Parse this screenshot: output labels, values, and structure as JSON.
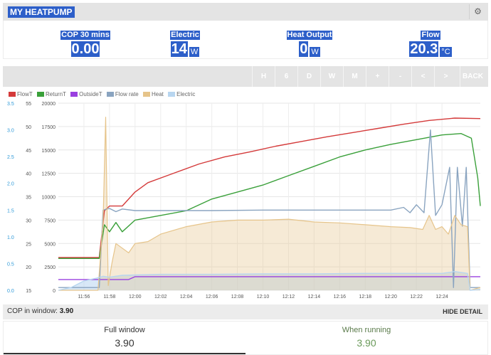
{
  "app": {
    "title": "MY HEATPUMP",
    "config_icon": "gear-icon"
  },
  "stats": [
    {
      "label": "COP 30 mins",
      "value": "0.00",
      "unit": ""
    },
    {
      "label": "Electric",
      "value": "14",
      "unit": "W"
    },
    {
      "label": "Heat Output",
      "value": "0",
      "unit": "W"
    },
    {
      "label": "Flow",
      "value": "20.3",
      "unit": "°C"
    }
  ],
  "toolbar": {
    "buttons": [
      "H",
      "6",
      "D",
      "W",
      "M",
      "+",
      "-",
      "<",
      ">",
      "BACK"
    ]
  },
  "cop_window": {
    "label": "COP in window:",
    "value": "3.90",
    "hide_detail": "HIDE DETAIL"
  },
  "summary": {
    "full_window": {
      "label": "Full window",
      "value": "3.90"
    },
    "when_running": {
      "label": "When running",
      "value": "3.90"
    }
  },
  "chart_data": {
    "type": "line",
    "legend": [
      {
        "name": "FlowT",
        "color": "#d43a3a"
      },
      {
        "name": "ReturnT",
        "color": "#3aa03a"
      },
      {
        "name": "OutsideT",
        "color": "#9a40e0"
      },
      {
        "name": "Flow rate",
        "color": "#8aa4c0"
      },
      {
        "name": "Heat",
        "color": "#e6c48a"
      },
      {
        "name": "Electric",
        "color": "#b8d6f0"
      }
    ],
    "x_ticks": [
      "11:56",
      "11:58",
      "12:00",
      "12:02",
      "12:04",
      "12:06",
      "12:08",
      "12:10",
      "12:12",
      "12:14",
      "12:16",
      "12:18",
      "12:20",
      "12:22",
      "12:24"
    ],
    "x_range_minutes": [
      0,
      33
    ],
    "axis_flowrate": {
      "ticks": [
        "0.0",
        "0.5",
        "1.0",
        "1.5",
        "2.0",
        "2.5",
        "3.0",
        "3.5"
      ],
      "range": [
        0,
        3.5
      ],
      "color": "#2f9ad8"
    },
    "axis_temp": {
      "ticks": [
        "15",
        "20",
        "25",
        "30",
        "35",
        "40",
        "45",
        "50",
        "55"
      ],
      "range": [
        15,
        55
      ]
    },
    "axis_power": {
      "ticks": [
        "0",
        "2500",
        "5000",
        "7500",
        "10000",
        "12500",
        "15000",
        "17500",
        "20000"
      ],
      "range": [
        0,
        20000
      ]
    },
    "series": [
      {
        "name": "FlowT",
        "axis": "temp",
        "color": "#d43a3a",
        "points": [
          [
            0,
            22
          ],
          [
            3.2,
            22
          ],
          [
            3.6,
            32
          ],
          [
            4,
            33
          ],
          [
            5,
            33
          ],
          [
            6,
            36
          ],
          [
            7,
            38
          ],
          [
            9,
            40
          ],
          [
            11,
            42
          ],
          [
            13,
            43.5
          ],
          [
            15,
            44.6
          ],
          [
            17,
            45.8
          ],
          [
            19,
            46.8
          ],
          [
            21,
            47.8
          ],
          [
            23,
            48.7
          ],
          [
            25,
            49.6
          ],
          [
            27,
            50.5
          ],
          [
            29,
            51.3
          ],
          [
            31,
            51.8
          ],
          [
            33,
            51.7
          ]
        ]
      },
      {
        "name": "ReturnT",
        "axis": "temp",
        "color": "#3aa03a",
        "points": [
          [
            0,
            21.8
          ],
          [
            3.2,
            21.8
          ],
          [
            3.6,
            29
          ],
          [
            4,
            27.5
          ],
          [
            4.5,
            29.5
          ],
          [
            5,
            27.5
          ],
          [
            6,
            30
          ],
          [
            8,
            31
          ],
          [
            10,
            32
          ],
          [
            12,
            34.5
          ],
          [
            14,
            36
          ],
          [
            16,
            37.5
          ],
          [
            18,
            39.5
          ],
          [
            20,
            41.5
          ],
          [
            22,
            43.5
          ],
          [
            24,
            45
          ],
          [
            26,
            46.2
          ],
          [
            28,
            47.2
          ],
          [
            30,
            48.2
          ],
          [
            31.5,
            48.5
          ],
          [
            32.3,
            47.5
          ],
          [
            32.8,
            39
          ],
          [
            33,
            33
          ]
        ]
      },
      {
        "name": "OutsideT",
        "axis": "temp",
        "color": "#9a40e0",
        "points": [
          [
            0,
            17.3
          ],
          [
            5.5,
            17.3
          ],
          [
            6,
            17.9
          ],
          [
            33,
            17.9
          ]
        ]
      },
      {
        "name": "Flow rate",
        "axis": "flowrate",
        "color": "#8aa4c0",
        "points": [
          [
            0,
            0.05
          ],
          [
            3.2,
            0.05
          ],
          [
            3.5,
            1.5
          ],
          [
            4,
            1.53
          ],
          [
            4.5,
            1.47
          ],
          [
            5,
            1.52
          ],
          [
            6,
            1.49
          ],
          [
            8,
            1.49
          ],
          [
            12,
            1.49
          ],
          [
            16,
            1.5
          ],
          [
            20,
            1.5
          ],
          [
            24,
            1.5
          ],
          [
            26,
            1.5
          ],
          [
            27,
            1.55
          ],
          [
            27.5,
            1.45
          ],
          [
            28,
            1.6
          ],
          [
            28.6,
            1.45
          ],
          [
            29.1,
            3.0
          ],
          [
            29.5,
            1.4
          ],
          [
            30,
            1.6
          ],
          [
            30.6,
            2.3
          ],
          [
            30.9,
            0.05
          ],
          [
            31.2,
            2.3
          ],
          [
            31.6,
            1.2
          ],
          [
            31.9,
            2.3
          ],
          [
            32.2,
            0.05
          ],
          [
            33,
            0.05
          ]
        ]
      },
      {
        "name": "Heat",
        "axis": "power",
        "color": "#e6c48a",
        "points": [
          [
            0,
            0
          ],
          [
            3.1,
            0
          ],
          [
            3.5,
            7500
          ],
          [
            3.7,
            18500
          ],
          [
            3.9,
            500
          ],
          [
            4.2,
            3000
          ],
          [
            4.5,
            5000
          ],
          [
            5,
            4500
          ],
          [
            5.5,
            4000
          ],
          [
            6,
            5000
          ],
          [
            7,
            5200
          ],
          [
            8,
            6000
          ],
          [
            10,
            6800
          ],
          [
            12,
            7300
          ],
          [
            14,
            7500
          ],
          [
            16,
            7500
          ],
          [
            18,
            7600
          ],
          [
            20,
            7300
          ],
          [
            22,
            7200
          ],
          [
            24,
            7000
          ],
          [
            26,
            6800
          ],
          [
            27.5,
            6700
          ],
          [
            28.5,
            6500
          ],
          [
            29,
            8000
          ],
          [
            29.5,
            6500
          ],
          [
            30,
            6800
          ],
          [
            30.5,
            6000
          ],
          [
            31,
            8000
          ],
          [
            31.5,
            7000
          ],
          [
            32,
            6800
          ],
          [
            32.2,
            0
          ],
          [
            33,
            300
          ]
        ]
      },
      {
        "name": "Electric",
        "axis": "power",
        "color": "#b8d6f0",
        "points": [
          [
            0,
            0
          ],
          [
            1,
            300
          ],
          [
            2,
            1000
          ],
          [
            3,
            1300
          ],
          [
            3.5,
            1500
          ],
          [
            4,
            1400
          ],
          [
            5,
            1600
          ],
          [
            8,
            1700
          ],
          [
            12,
            1700
          ],
          [
            16,
            1750
          ],
          [
            20,
            1750
          ],
          [
            24,
            1800
          ],
          [
            28,
            1800
          ],
          [
            30,
            1800
          ],
          [
            31,
            2000
          ],
          [
            32,
            1800
          ],
          [
            32.2,
            0
          ],
          [
            33,
            100
          ]
        ]
      }
    ]
  }
}
